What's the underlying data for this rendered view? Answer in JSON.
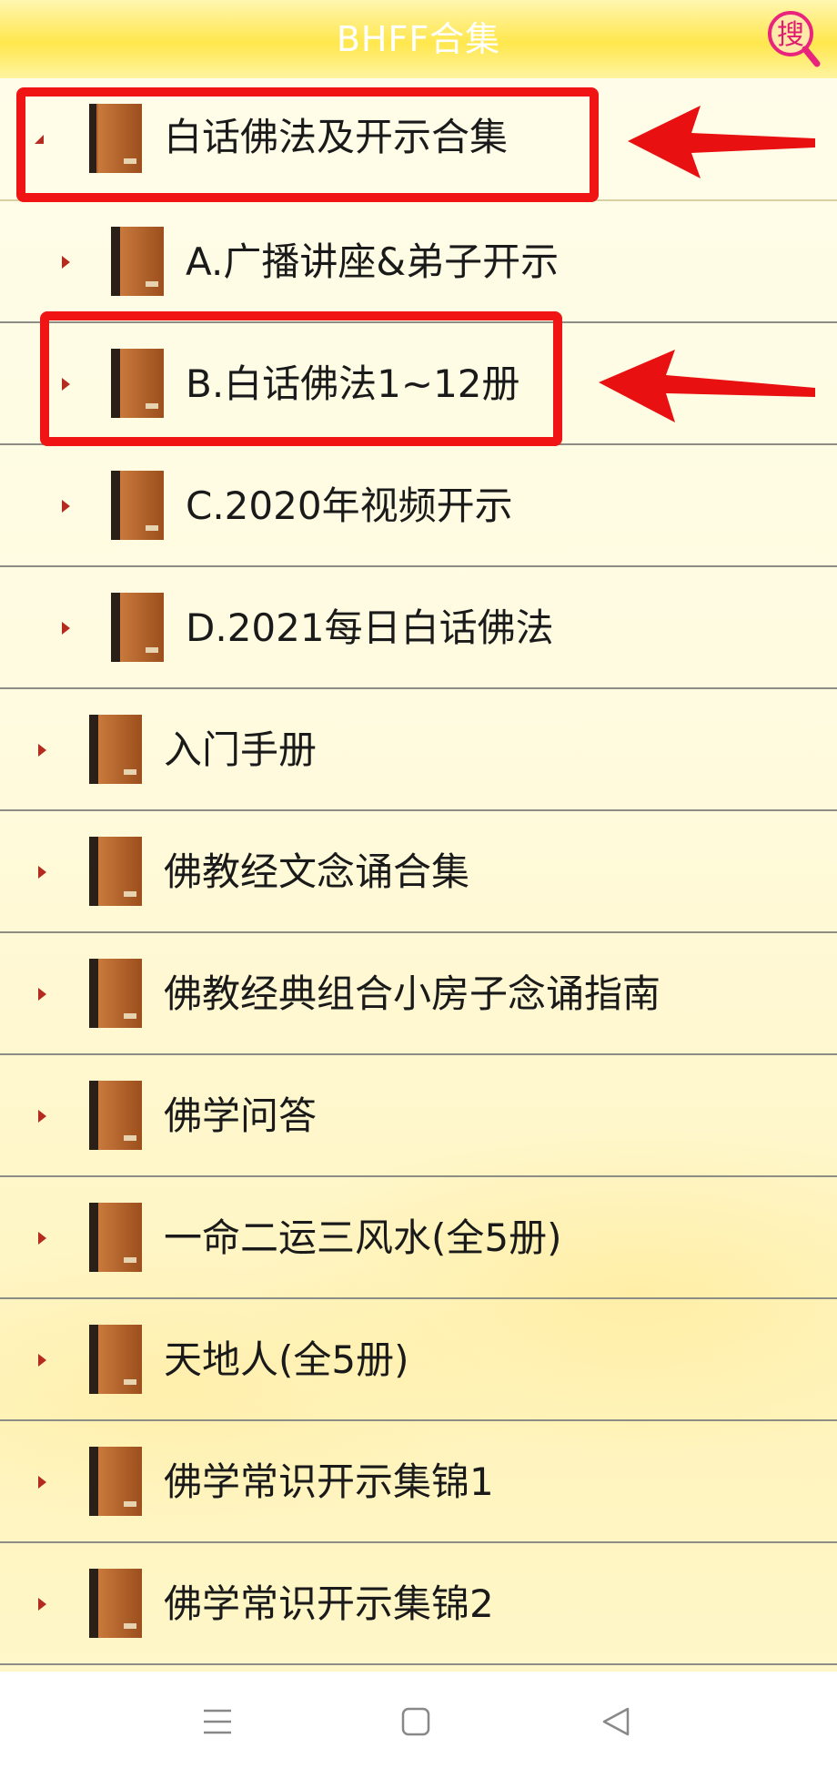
{
  "header": {
    "title": "BHFF合集",
    "search_icon_text": "搜"
  },
  "list": {
    "items": [
      {
        "label": "白话佛法及开示合集",
        "level": 0,
        "expanded": true
      },
      {
        "label": "A.广播讲座&弟子开示",
        "level": 1
      },
      {
        "label": "B.白话佛法1~12册",
        "level": 1
      },
      {
        "label": "C.2020年视频开示",
        "level": 1
      },
      {
        "label": "D.2021每日白话佛法",
        "level": 1
      },
      {
        "label": "入门手册",
        "level": 0
      },
      {
        "label": "佛教经文念诵合集",
        "level": 0
      },
      {
        "label": "佛教经典组合小房子念诵指南",
        "level": 0
      },
      {
        "label": "佛学问答",
        "level": 0
      },
      {
        "label": "一命二运三风水(全5册)",
        "level": 0
      },
      {
        "label": "天地人(全5册)",
        "level": 0
      },
      {
        "label": "佛学常识开示集锦1",
        "level": 0
      },
      {
        "label": "佛学常识开示集锦2",
        "level": 0
      }
    ]
  },
  "icons": {
    "expand_arrow": "triangle-right-icon",
    "collapse_arrow": "triangle-down-icon",
    "book": "book-icon",
    "search": "search-icon",
    "menu": "menu-icon",
    "home": "home-icon",
    "back": "back-icon"
  },
  "colors": {
    "header": "#ffe74d",
    "highlight_box": "#f01414",
    "arrow": "#b52b20",
    "book": "#b5642b"
  }
}
